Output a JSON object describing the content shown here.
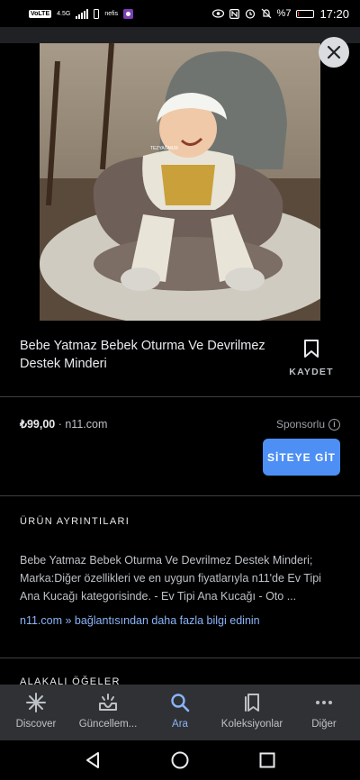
{
  "status_bar": {
    "time": "17:20",
    "battery": "%7",
    "battery_level": 0.07,
    "left_badge": "VoLTE",
    "signal_text": "4.5G",
    "speed_text": "nefis",
    "icons": [
      "eye-icon",
      "nfc-icon",
      "alarm-icon",
      "mute-icon",
      "battery-icon"
    ]
  },
  "product": {
    "title": "Bebe Yatmaz Bebek Oturma Ve Devrilmez Destek Minderi",
    "image_watermark": "TEZYAĞMUR"
  },
  "save": {
    "label": "KAYDET"
  },
  "offer": {
    "price": "₺99,00",
    "separator": " · ",
    "store": "n11.com",
    "sponsored": "Sponsorlu",
    "visit_button": "SİTEYE GİT"
  },
  "details": {
    "heading": "ÜRÜN AYRINTILARI",
    "description": "Bebe Yatmaz Bebek Oturma Ve Devrilmez Destek Minderi; Marka:Diğer özellikleri ve en uygun fiyatlarıyla n11'de Ev Tipi Ana Kucağı kategorisinde. - Ev Tipi Ana Kucağı - Oto ...",
    "more_link": "n11.com » bağlantısından daha fazla bilgi edinin"
  },
  "related": {
    "heading": "ALAKALI ÖĞELER"
  },
  "bottom_nav": {
    "items": [
      {
        "label": "Discover",
        "icon": "asterisk-icon",
        "active": false
      },
      {
        "label": "Güncellem...",
        "icon": "updates-icon",
        "active": false
      },
      {
        "label": "Ara",
        "icon": "search-icon",
        "active": true
      },
      {
        "label": "Koleksiyonlar",
        "icon": "collections-icon",
        "active": false
      },
      {
        "label": "Diğer",
        "icon": "more-icon",
        "active": false
      }
    ]
  },
  "colors": {
    "background": "#000000",
    "accent": "#4d8ff4",
    "link": "#8ab4f8",
    "nav_bg": "#303134"
  }
}
